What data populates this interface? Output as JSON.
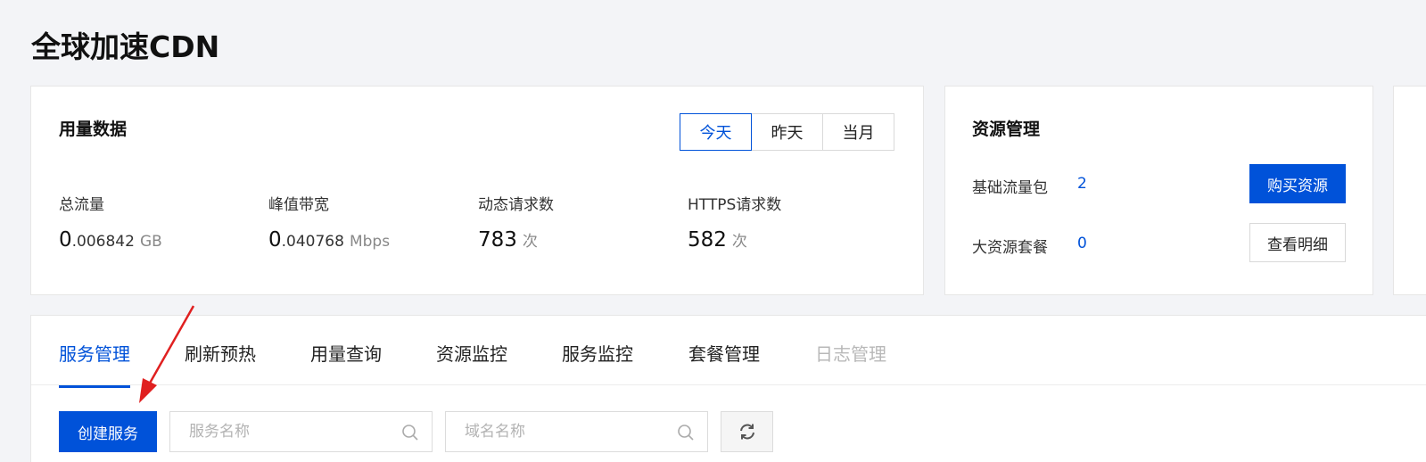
{
  "page": {
    "title": "全球加速CDN"
  },
  "usage": {
    "title": "用量数据",
    "periods": [
      "今天",
      "昨天",
      "当月"
    ],
    "active_period": "今天",
    "metrics": [
      {
        "label": "总流量",
        "big": "0",
        "small": ".006842",
        "unit": "GB"
      },
      {
        "label": "峰值带宽",
        "big": "0",
        "small": ".040768",
        "unit": "Mbps"
      },
      {
        "label": "动态请求数",
        "big": "783",
        "small": "",
        "unit": "次"
      },
      {
        "label": "HTTPS请求数",
        "big": "582",
        "small": "",
        "unit": "次"
      }
    ]
  },
  "resources": {
    "title": "资源管理",
    "rows": [
      {
        "label": "基础流量包",
        "value": "2"
      },
      {
        "label": "大资源套餐",
        "value": "0"
      }
    ],
    "buy_button": "购买资源",
    "detail_button": "查看明细"
  },
  "tabs": [
    "服务管理",
    "刷新预热",
    "用量查询",
    "资源监控",
    "服务监控",
    "套餐管理",
    "日志管理"
  ],
  "toolbar": {
    "create_button": "创建服务",
    "service_search_placeholder": "服务名称",
    "domain_search_placeholder": "域名名称"
  },
  "colors": {
    "accent": "#0052d9",
    "annotation_arrow": "#e02020"
  }
}
